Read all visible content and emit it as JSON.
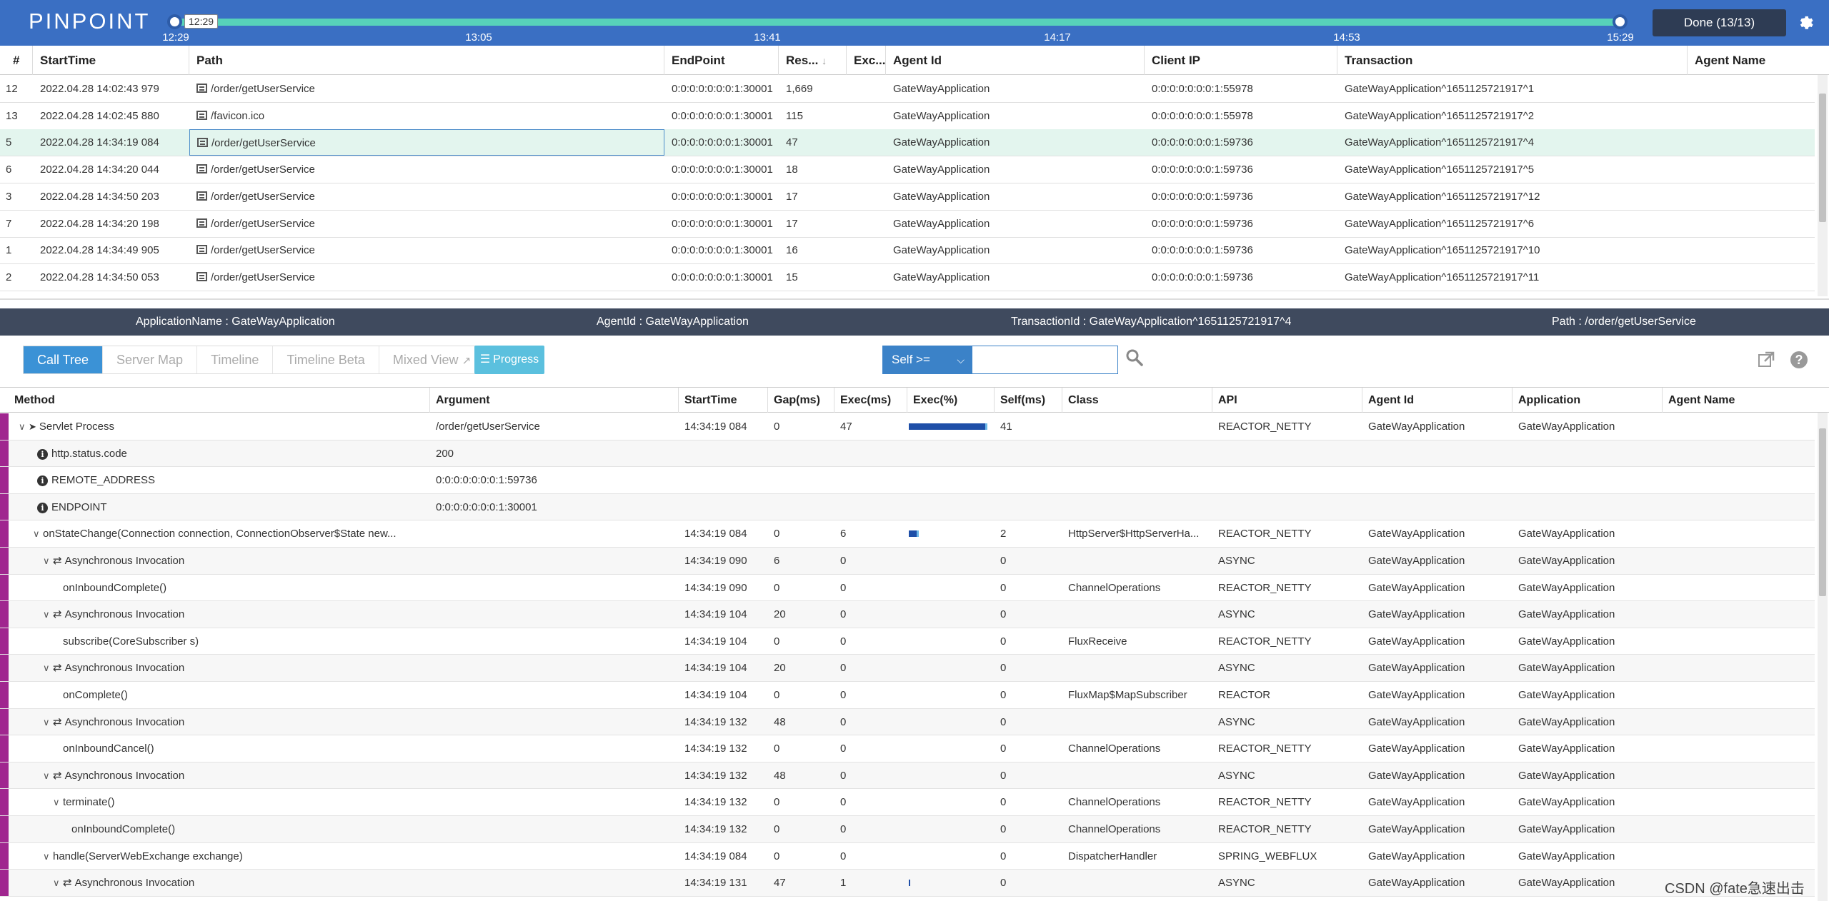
{
  "header": {
    "logo": "PINPOINT",
    "timeline": {
      "current_label": "12:29",
      "ticks": [
        "12:29",
        "13:05",
        "13:41",
        "14:17",
        "14:53",
        "15:29"
      ]
    },
    "done_label": "Done (13/13)",
    "settings_icon": "gear-icon"
  },
  "tx_list": {
    "columns": [
      "#",
      "StartTime",
      "Path",
      "EndPoint",
      "Res...",
      "Exc...",
      "Agent Id",
      "Client IP",
      "Transaction",
      "Agent Name"
    ],
    "rows": [
      {
        "num": "12",
        "start": "2022.04.28 14:02:43 979",
        "path": "/order/getUserService",
        "endpoint": "0:0:0:0:0:0:0:1:30001",
        "res": "1,669",
        "exc": "",
        "agent": "GateWayApplication",
        "client": "0:0:0:0:0:0:0:1:55978",
        "transaction": "GateWayApplication^1651125721917^1"
      },
      {
        "num": "13",
        "start": "2022.04.28 14:02:45 880",
        "path": "/favicon.ico",
        "endpoint": "0:0:0:0:0:0:0:1:30001",
        "res": "115",
        "exc": "",
        "agent": "GateWayApplication",
        "client": "0:0:0:0:0:0:0:1:55978",
        "transaction": "GateWayApplication^1651125721917^2"
      },
      {
        "num": "5",
        "start": "2022.04.28 14:34:19 084",
        "path": "/order/getUserService",
        "endpoint": "0:0:0:0:0:0:0:1:30001",
        "res": "47",
        "exc": "",
        "agent": "GateWayApplication",
        "client": "0:0:0:0:0:0:0:1:59736",
        "transaction": "GateWayApplication^1651125721917^4"
      },
      {
        "num": "6",
        "start": "2022.04.28 14:34:20 044",
        "path": "/order/getUserService",
        "endpoint": "0:0:0:0:0:0:0:1:30001",
        "res": "18",
        "exc": "",
        "agent": "GateWayApplication",
        "client": "0:0:0:0:0:0:0:1:59736",
        "transaction": "GateWayApplication^1651125721917^5"
      },
      {
        "num": "3",
        "start": "2022.04.28 14:34:50 203",
        "path": "/order/getUserService",
        "endpoint": "0:0:0:0:0:0:0:1:30001",
        "res": "17",
        "exc": "",
        "agent": "GateWayApplication",
        "client": "0:0:0:0:0:0:0:1:59736",
        "transaction": "GateWayApplication^1651125721917^12"
      },
      {
        "num": "7",
        "start": "2022.04.28 14:34:20 198",
        "path": "/order/getUserService",
        "endpoint": "0:0:0:0:0:0:0:1:30001",
        "res": "17",
        "exc": "",
        "agent": "GateWayApplication",
        "client": "0:0:0:0:0:0:0:1:59736",
        "transaction": "GateWayApplication^1651125721917^6"
      },
      {
        "num": "1",
        "start": "2022.04.28 14:34:49 905",
        "path": "/order/getUserService",
        "endpoint": "0:0:0:0:0:0:0:1:30001",
        "res": "16",
        "exc": "",
        "agent": "GateWayApplication",
        "client": "0:0:0:0:0:0:0:1:59736",
        "transaction": "GateWayApplication^1651125721917^10"
      },
      {
        "num": "2",
        "start": "2022.04.28 14:34:50 053",
        "path": "/order/getUserService",
        "endpoint": "0:0:0:0:0:0:0:1:30001",
        "res": "15",
        "exc": "",
        "agent": "GateWayApplication",
        "client": "0:0:0:0:0:0:0:1:59736",
        "transaction": "GateWayApplication^1651125721917^11"
      }
    ]
  },
  "info_bar": {
    "application": "ApplicationName : GateWayApplication",
    "agent": "AgentId : GateWayApplication",
    "transaction": "TransactionId : GateWayApplication^1651125721917^4",
    "path": "Path : /order/getUserService"
  },
  "toolbar": {
    "tabs": [
      "Call Tree",
      "Server Map",
      "Timeline",
      "Timeline Beta",
      "Mixed View"
    ],
    "progress_label": "Progress",
    "filter_label": "Self >=",
    "filter_value": ""
  },
  "call_tree": {
    "columns": [
      "Method",
      "Argument",
      "StartTime",
      "Gap(ms)",
      "Exec(ms)",
      "Exec(%)",
      "Self(ms)",
      "Class",
      "API",
      "Agent Id",
      "Application",
      "Agent Name"
    ],
    "rows": [
      {
        "caret": "v",
        "icon": "send",
        "method": "Servlet Process",
        "arg": "/order/getUserService",
        "start": "14:34:19 084",
        "gap": "0",
        "exec": "47",
        "pct": 1.0,
        "selfpct": 0.13,
        "self": "41",
        "cls": "",
        "api": "REACTOR_NETTY",
        "agent": "GateWayApplication",
        "app": "GateWayApplication"
      },
      {
        "caret": "",
        "icon": "info",
        "method": "http.status.code",
        "arg": "200",
        "start": "",
        "gap": "",
        "exec": "",
        "pct": null,
        "selfpct": null,
        "self": "",
        "cls": "",
        "api": "",
        "agent": "",
        "app": ""
      },
      {
        "caret": "",
        "icon": "info",
        "method": "REMOTE_ADDRESS",
        "arg": "0:0:0:0:0:0:0:1:59736",
        "start": "",
        "gap": "",
        "exec": "",
        "pct": null,
        "selfpct": null,
        "self": "",
        "cls": "",
        "api": "",
        "agent": "",
        "app": ""
      },
      {
        "caret": "",
        "icon": "info",
        "method": "ENDPOINT",
        "arg": "0:0:0:0:0:0:0:1:30001",
        "start": "",
        "gap": "",
        "exec": "",
        "pct": null,
        "selfpct": null,
        "self": "",
        "cls": "",
        "api": "",
        "agent": "",
        "app": ""
      },
      {
        "caret": "v",
        "icon": "",
        "method": "onStateChange(Connection connection, ConnectionObserver$State new...",
        "arg": "",
        "start": "14:34:19 084",
        "gap": "0",
        "exec": "6",
        "pct": 0.13,
        "selfpct": 0.04,
        "self": "2",
        "cls": "HttpServer$HttpServerHa...",
        "api": "REACTOR_NETTY",
        "agent": "GateWayApplication",
        "app": "GateWayApplication"
      },
      {
        "caret": "v",
        "icon": "async",
        "method": "Asynchronous Invocation",
        "arg": "",
        "start": "14:34:19 090",
        "gap": "6",
        "exec": "0",
        "pct": null,
        "selfpct": null,
        "self": "0",
        "cls": "",
        "api": "ASYNC",
        "agent": "GateWayApplication",
        "app": "GateWayApplication"
      },
      {
        "caret": "",
        "icon": "",
        "method": "onInboundComplete()",
        "arg": "",
        "start": "14:34:19 090",
        "gap": "0",
        "exec": "0",
        "pct": null,
        "selfpct": null,
        "self": "0",
        "cls": "ChannelOperations",
        "api": "REACTOR_NETTY",
        "agent": "GateWayApplication",
        "app": "GateWayApplication"
      },
      {
        "caret": "v",
        "icon": "async",
        "method": "Asynchronous Invocation",
        "arg": "",
        "start": "14:34:19 104",
        "gap": "20",
        "exec": "0",
        "pct": null,
        "selfpct": null,
        "self": "0",
        "cls": "",
        "api": "ASYNC",
        "agent": "GateWayApplication",
        "app": "GateWayApplication"
      },
      {
        "caret": "",
        "icon": "",
        "method": "subscribe(CoreSubscriber s)",
        "arg": "",
        "start": "14:34:19 104",
        "gap": "0",
        "exec": "0",
        "pct": null,
        "selfpct": null,
        "self": "0",
        "cls": "FluxReceive",
        "api": "REACTOR_NETTY",
        "agent": "GateWayApplication",
        "app": "GateWayApplication"
      },
      {
        "caret": "v",
        "icon": "async",
        "method": "Asynchronous Invocation",
        "arg": "",
        "start": "14:34:19 104",
        "gap": "20",
        "exec": "0",
        "pct": null,
        "selfpct": null,
        "self": "0",
        "cls": "",
        "api": "ASYNC",
        "agent": "GateWayApplication",
        "app": "GateWayApplication"
      },
      {
        "caret": "",
        "icon": "",
        "method": "onComplete()",
        "arg": "",
        "start": "14:34:19 104",
        "gap": "0",
        "exec": "0",
        "pct": null,
        "selfpct": null,
        "self": "0",
        "cls": "FluxMap$MapSubscriber",
        "api": "REACTOR",
        "agent": "GateWayApplication",
        "app": "GateWayApplication"
      },
      {
        "caret": "v",
        "icon": "async",
        "method": "Asynchronous Invocation",
        "arg": "",
        "start": "14:34:19 132",
        "gap": "48",
        "exec": "0",
        "pct": null,
        "selfpct": null,
        "self": "0",
        "cls": "",
        "api": "ASYNC",
        "agent": "GateWayApplication",
        "app": "GateWayApplication"
      },
      {
        "caret": "",
        "icon": "",
        "method": "onInboundCancel()",
        "arg": "",
        "start": "14:34:19 132",
        "gap": "0",
        "exec": "0",
        "pct": null,
        "selfpct": null,
        "self": "0",
        "cls": "ChannelOperations",
        "api": "REACTOR_NETTY",
        "agent": "GateWayApplication",
        "app": "GateWayApplication"
      },
      {
        "caret": "v",
        "icon": "async",
        "method": "Asynchronous Invocation",
        "arg": "",
        "start": "14:34:19 132",
        "gap": "48",
        "exec": "0",
        "pct": null,
        "selfpct": null,
        "self": "0",
        "cls": "",
        "api": "ASYNC",
        "agent": "GateWayApplication",
        "app": "GateWayApplication"
      },
      {
        "caret": "v",
        "icon": "",
        "method": "terminate()",
        "arg": "",
        "start": "14:34:19 132",
        "gap": "0",
        "exec": "0",
        "pct": null,
        "selfpct": null,
        "self": "0",
        "cls": "ChannelOperations",
        "api": "REACTOR_NETTY",
        "agent": "GateWayApplication",
        "app": "GateWayApplication"
      },
      {
        "caret": "",
        "icon": "",
        "method": "onInboundComplete()",
        "arg": "",
        "start": "14:34:19 132",
        "gap": "0",
        "exec": "0",
        "pct": null,
        "selfpct": null,
        "self": "0",
        "cls": "ChannelOperations",
        "api": "REACTOR_NETTY",
        "agent": "GateWayApplication",
        "app": "GateWayApplication"
      },
      {
        "caret": "v",
        "icon": "",
        "method": "handle(ServerWebExchange exchange)",
        "arg": "",
        "start": "14:34:19 084",
        "gap": "0",
        "exec": "0",
        "pct": null,
        "selfpct": null,
        "self": "0",
        "cls": "DispatcherHandler",
        "api": "SPRING_WEBFLUX",
        "agent": "GateWayApplication",
        "app": "GateWayApplication"
      },
      {
        "caret": "v",
        "icon": "async",
        "method": "Asynchronous Invocation",
        "arg": "",
        "start": "14:34:19 131",
        "gap": "47",
        "exec": "1",
        "pct": 0.02,
        "selfpct": null,
        "self": "0",
        "cls": "",
        "api": "ASYNC",
        "agent": "GateWayApplication",
        "app": "GateWayApplication"
      }
    ]
  },
  "watermark": "CSDN @fate急速出击"
}
